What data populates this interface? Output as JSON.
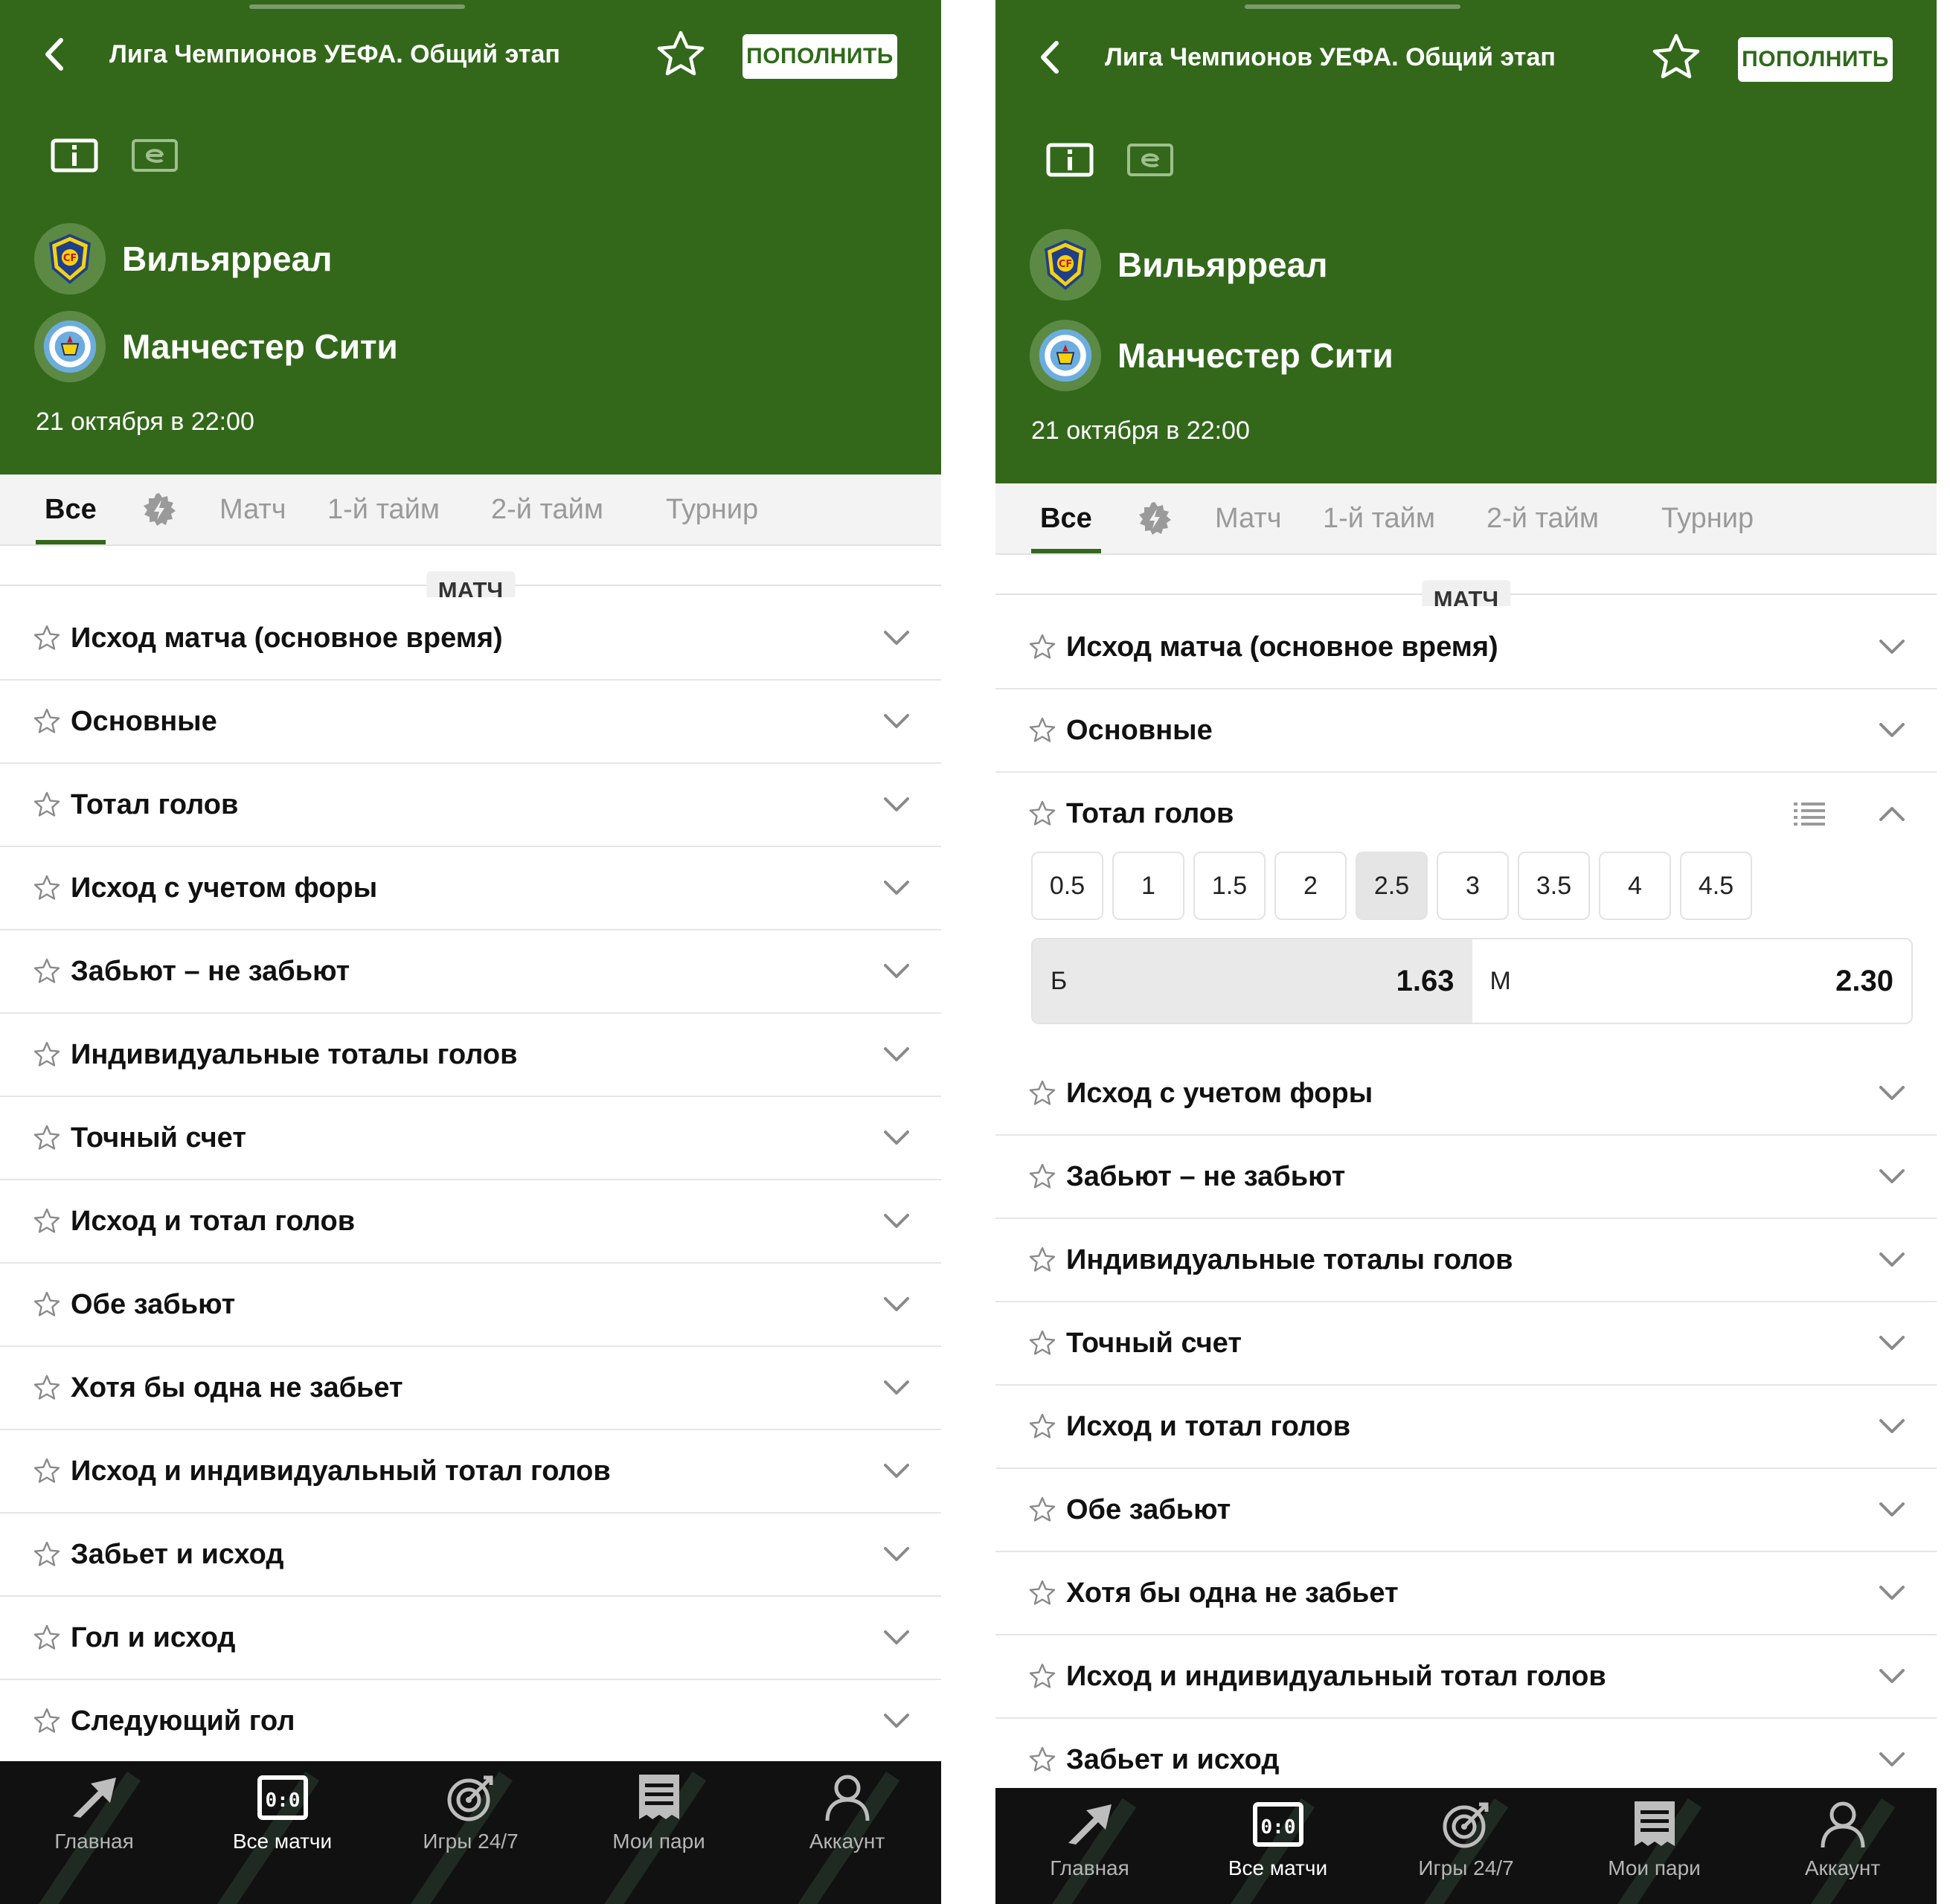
{
  "header": {
    "league": "Лига Чемпионов УЕФА. Общий этап",
    "topup_label": "ПОПОЛНИТЬ",
    "team1": "Вильярреал",
    "team2": "Манчестер Сити",
    "datetime": "21 октября в 22:00"
  },
  "tabs": [
    "Все",
    "Матч",
    "1-й тайм",
    "2-й тайм",
    "Турнир"
  ],
  "section_label": "МАТЧ",
  "markets": [
    "Исход матча (основное время)",
    "Основные",
    "Тотал голов",
    "Исход с учетом форы",
    "Забьют – не забьют",
    "Индивидуальные тоталы голов",
    "Точный счет",
    "Исход и тотал голов",
    "Обе забьют",
    "Хотя бы одна не забьет",
    "Исход и индивидуальный тотал голов",
    "Забьет и исход",
    "Гол и исход",
    "Следующий гол"
  ],
  "total_goals": {
    "lines": [
      "0.5",
      "1",
      "1.5",
      "2",
      "2.5",
      "3",
      "3.5",
      "4",
      "4.5"
    ],
    "selected_line": "2.5",
    "over_label": "Б",
    "over_odds": "1.63",
    "under_label": "М",
    "under_odds": "2.30"
  },
  "bottom_nav": [
    {
      "label": "Главная",
      "icon": "arrow-icon"
    },
    {
      "label": "Все матчи",
      "icon": "scoreboard-icon",
      "active": true
    },
    {
      "label": "Игры 24/7",
      "icon": "target-icon"
    },
    {
      "label": "Мои пари",
      "icon": "receipt-icon"
    },
    {
      "label": "Аккаунт",
      "icon": "person-icon"
    }
  ],
  "colors": {
    "header_green": "#33681b",
    "bottom_bar": "#111111"
  }
}
